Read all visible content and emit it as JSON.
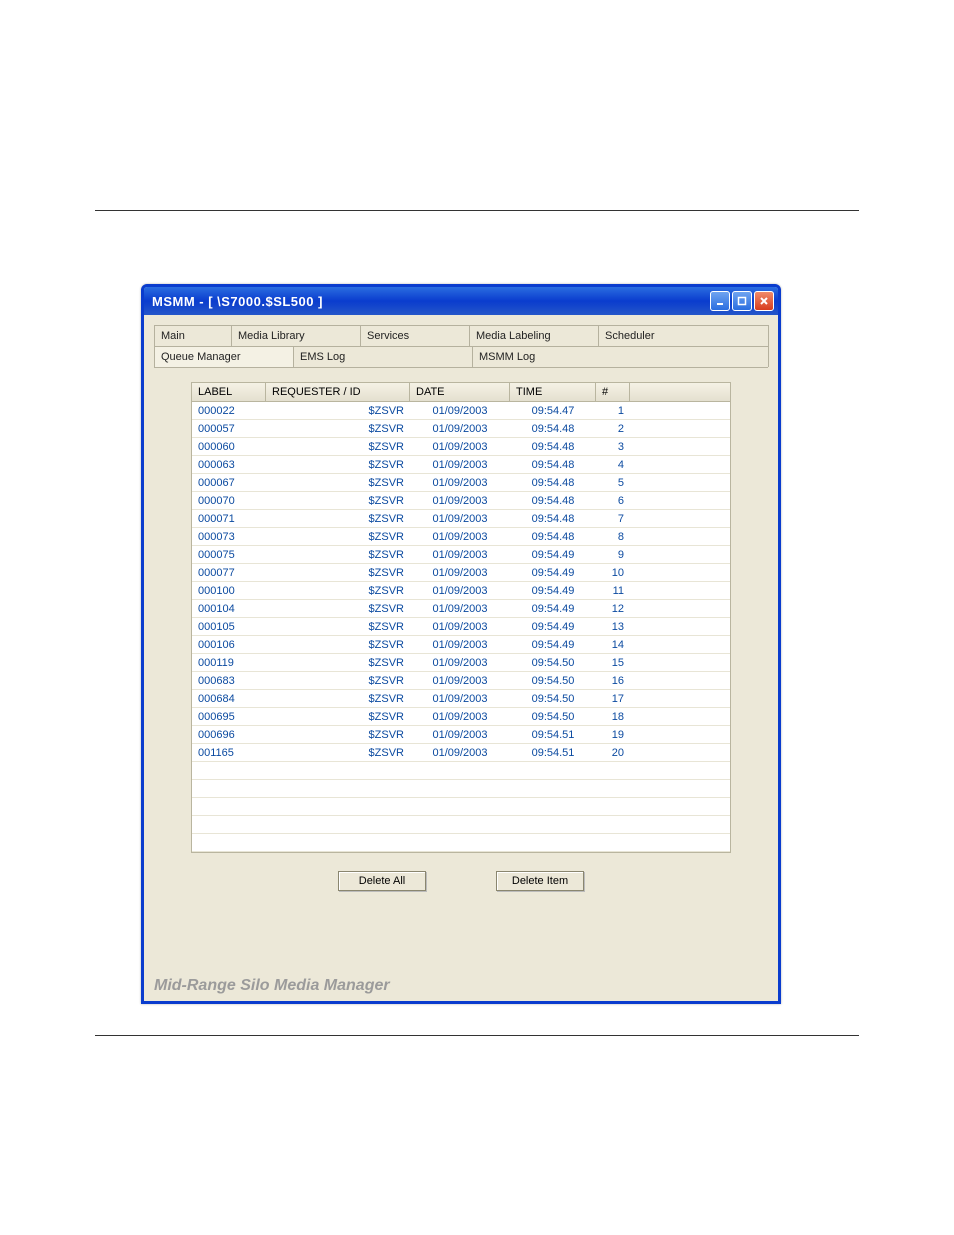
{
  "doc_link": "",
  "window": {
    "title": "MSMM - [ \\S7000.$SL500 ]",
    "footer": "Mid-Range Silo Media Manager"
  },
  "tabs_row1": [
    "Main",
    "Media Library",
    "Services",
    "Media Labeling",
    "Scheduler"
  ],
  "tabs_row2": [
    "Queue Manager",
    "EMS Log",
    "MSMM Log"
  ],
  "columns": {
    "label": "LABEL",
    "requester": "REQUESTER / ID",
    "date": "DATE",
    "time": "TIME",
    "num": "#"
  },
  "rows": [
    {
      "label": "000022",
      "req": "$ZSVR",
      "date": "01/09/2003",
      "time": "09:54.47",
      "n": "1"
    },
    {
      "label": "000057",
      "req": "$ZSVR",
      "date": "01/09/2003",
      "time": "09:54.48",
      "n": "2"
    },
    {
      "label": "000060",
      "req": "$ZSVR",
      "date": "01/09/2003",
      "time": "09:54.48",
      "n": "3"
    },
    {
      "label": "000063",
      "req": "$ZSVR",
      "date": "01/09/2003",
      "time": "09:54.48",
      "n": "4"
    },
    {
      "label": "000067",
      "req": "$ZSVR",
      "date": "01/09/2003",
      "time": "09:54.48",
      "n": "5"
    },
    {
      "label": "000070",
      "req": "$ZSVR",
      "date": "01/09/2003",
      "time": "09:54.48",
      "n": "6"
    },
    {
      "label": "000071",
      "req": "$ZSVR",
      "date": "01/09/2003",
      "time": "09:54.48",
      "n": "7"
    },
    {
      "label": "000073",
      "req": "$ZSVR",
      "date": "01/09/2003",
      "time": "09:54.48",
      "n": "8"
    },
    {
      "label": "000075",
      "req": "$ZSVR",
      "date": "01/09/2003",
      "time": "09:54.49",
      "n": "9"
    },
    {
      "label": "000077",
      "req": "$ZSVR",
      "date": "01/09/2003",
      "time": "09:54.49",
      "n": "10"
    },
    {
      "label": "000100",
      "req": "$ZSVR",
      "date": "01/09/2003",
      "time": "09:54.49",
      "n": "11"
    },
    {
      "label": "000104",
      "req": "$ZSVR",
      "date": "01/09/2003",
      "time": "09:54.49",
      "n": "12"
    },
    {
      "label": "000105",
      "req": "$ZSVR",
      "date": "01/09/2003",
      "time": "09:54.49",
      "n": "13"
    },
    {
      "label": "000106",
      "req": "$ZSVR",
      "date": "01/09/2003",
      "time": "09:54.49",
      "n": "14"
    },
    {
      "label": "000119",
      "req": "$ZSVR",
      "date": "01/09/2003",
      "time": "09:54.50",
      "n": "15"
    },
    {
      "label": "000683",
      "req": "$ZSVR",
      "date": "01/09/2003",
      "time": "09:54.50",
      "n": "16"
    },
    {
      "label": "000684",
      "req": "$ZSVR",
      "date": "01/09/2003",
      "time": "09:54.50",
      "n": "17"
    },
    {
      "label": "000695",
      "req": "$ZSVR",
      "date": "01/09/2003",
      "time": "09:54.50",
      "n": "18"
    },
    {
      "label": "000696",
      "req": "$ZSVR",
      "date": "01/09/2003",
      "time": "09:54.51",
      "n": "19"
    },
    {
      "label": "001165",
      "req": "$ZSVR",
      "date": "01/09/2003",
      "time": "09:54.51",
      "n": "20"
    }
  ],
  "empty_rows": 5,
  "buttons": {
    "delete_all": "Delete All",
    "delete_item": "Delete Item"
  }
}
